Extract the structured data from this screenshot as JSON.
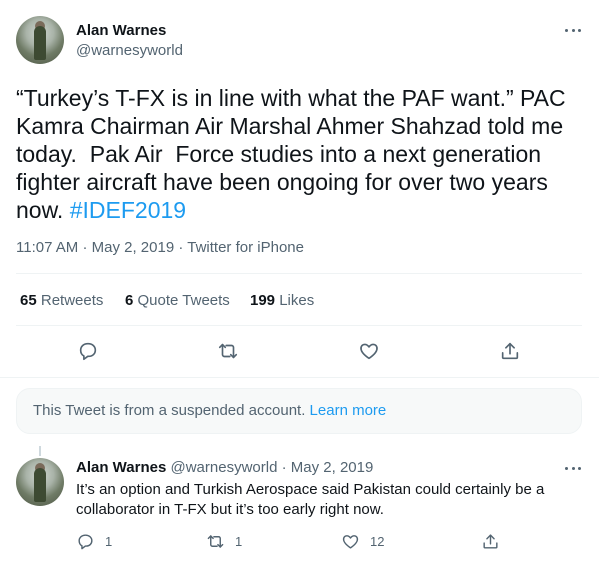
{
  "tweet": {
    "author_name": "Alan Warnes",
    "author_handle": "@warnesyworld",
    "text_before": "“Turkey’s T-FX is in line with what the PAF want.” PAC Kamra Chairman Air Marshal Ahmer Shahzad told me today.  Pak Air  Force studies into a next generation fighter aircraft have been ongoing for over two years now. ",
    "hashtag": "#IDEF2019",
    "time": "11:07 AM",
    "date": "May 2, 2019",
    "source": "Twitter for iPhone",
    "stats": {
      "retweets_count": "65",
      "retweets_label": "Retweets",
      "quotes_count": "6",
      "quotes_label": "Quote Tweets",
      "likes_count": "199",
      "likes_label": "Likes"
    }
  },
  "notice": {
    "text": "This Tweet is from a suspended account.",
    "link": "Learn more"
  },
  "reply": {
    "author_name": "Alan Warnes",
    "author_handle": "@warnesyworld",
    "date": "May 2, 2019",
    "text": "It’s an option and Turkish Aerospace said Pakistan could certainly be a collaborator in T-FX but it’s too early right now.",
    "reply_count": "1",
    "retweet_count": "1",
    "like_count": "12"
  },
  "icons": [
    "more-icon",
    "reply-icon",
    "retweet-icon",
    "like-icon",
    "share-icon"
  ]
}
